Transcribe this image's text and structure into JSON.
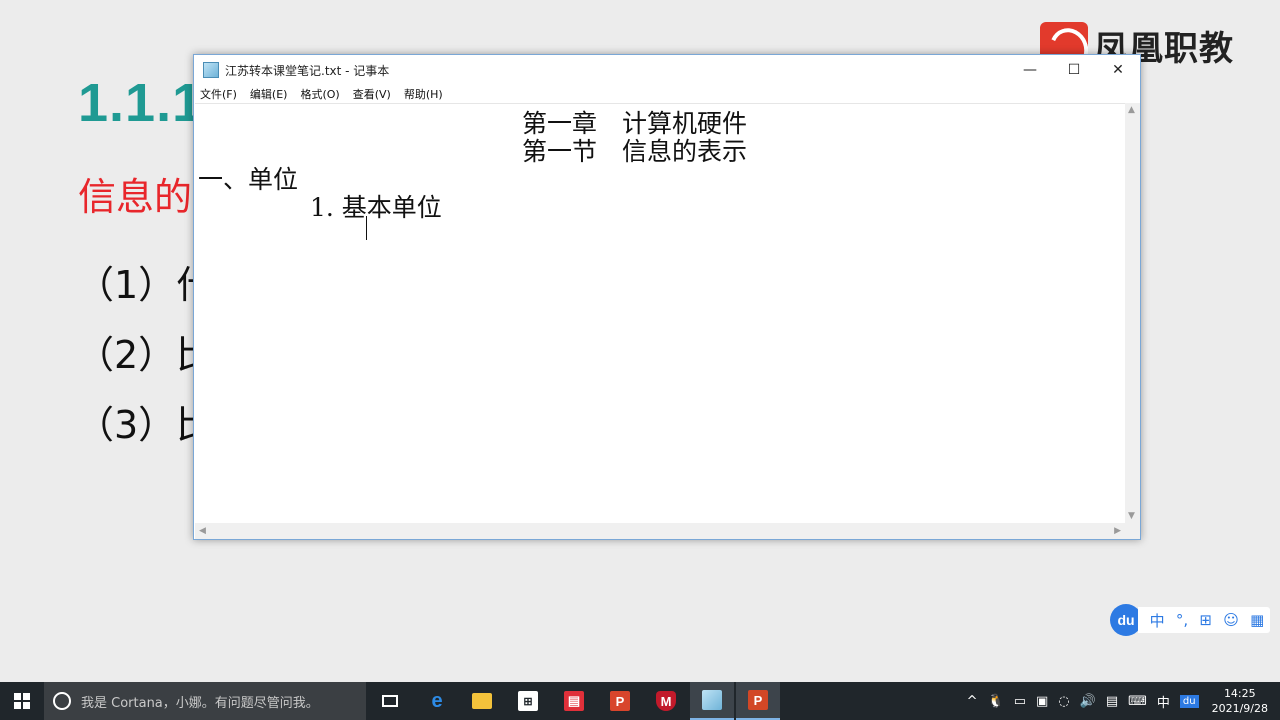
{
  "slide": {
    "title": "1.1.1",
    "subtitle": "信息的",
    "bullets": [
      "（1）什",
      "（2）比",
      "（3）比"
    ],
    "logo_text": "凤凰职教"
  },
  "window": {
    "title": "江苏转本课堂笔记.txt - 记事本",
    "controls": {
      "minimize": "—",
      "maximize": "☐",
      "close": "✕"
    },
    "menu": [
      "文件(F)",
      "编辑(E)",
      "格式(O)",
      "查看(V)",
      "帮助(H)"
    ],
    "lines": [
      "第一章　计算机硬件",
      "第一节　信息的表示",
      "一、单位",
      "1. 基本单位"
    ],
    "scroll_arrows": {
      "up": "▲",
      "down": "▼",
      "left": "◀",
      "right": "▶"
    }
  },
  "ime": {
    "logo": "du",
    "items": [
      "中",
      "°,",
      "⊞",
      "☺",
      "▦"
    ]
  },
  "taskbar": {
    "search_placeholder": "我是 Cortana，小娜。有问题尽管问我。",
    "tray": {
      "chevron": "^",
      "lang": "中",
      "time": "14:25",
      "date": "2021/9/28"
    }
  },
  "colors": {
    "title_teal": "#1f9a93",
    "subtitle_red": "#e8262b",
    "taskbar": "#20262b",
    "accent_blue": "#2d7ae3"
  }
}
